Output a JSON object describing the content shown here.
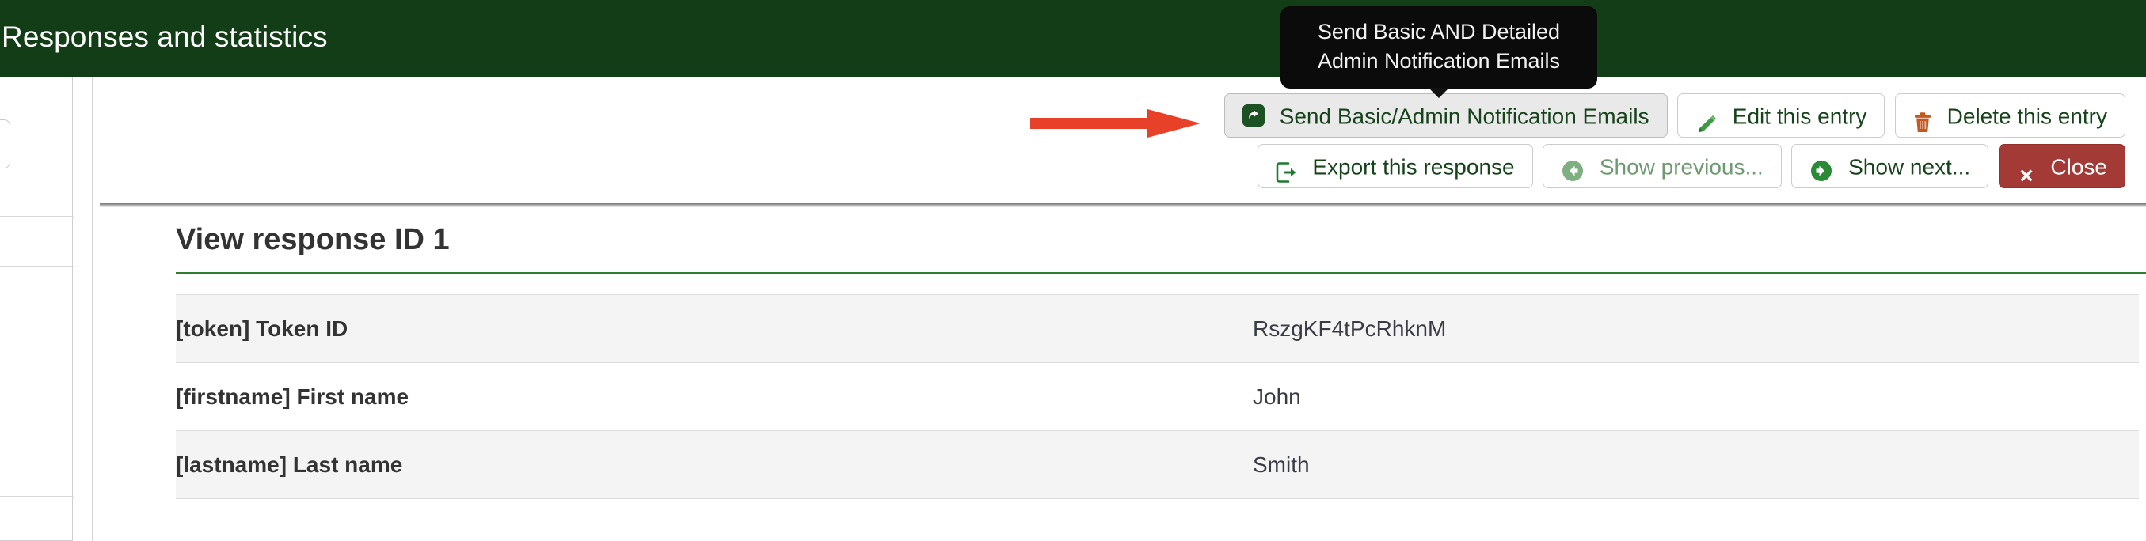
{
  "header": {
    "title": "Responses and statistics",
    "bg_color": "#123d16"
  },
  "tooltip": {
    "text": "Send Basic AND Detailed Admin Notification Emails"
  },
  "toolbar": {
    "row1": [
      {
        "id": "send-notification-emails",
        "label": "Send Basic/Admin Notification Emails",
        "icon": "share-square-icon",
        "state": "hovered"
      },
      {
        "id": "edit-entry",
        "label": "Edit this entry",
        "icon": "pencil-icon",
        "state": "normal"
      },
      {
        "id": "delete-entry",
        "label": "Delete this entry",
        "icon": "trash-icon",
        "state": "normal"
      }
    ],
    "row2": [
      {
        "id": "export-response",
        "label": "Export this response",
        "icon": "export-icon",
        "state": "normal"
      },
      {
        "id": "show-previous",
        "label": "Show previous...",
        "icon": "circle-arrow-left-icon",
        "state": "disabled"
      },
      {
        "id": "show-next",
        "label": "Show next...",
        "icon": "circle-arrow-right-icon",
        "state": "normal"
      },
      {
        "id": "close",
        "label": "Close",
        "icon": "times-icon",
        "state": "danger"
      }
    ]
  },
  "annotation": {
    "arrow_color": "#e8412a",
    "points_to": "send-notification-emails"
  },
  "panel": {
    "title": "View response ID 1",
    "accent_color": "#2e7d32"
  },
  "table": {
    "rows": [
      {
        "question": "[token] Token ID",
        "answer": "RszgKF4tPcRhknM"
      },
      {
        "question": "[firstname] First name",
        "answer": "John"
      },
      {
        "question": "[lastname] Last name",
        "answer": "Smith"
      }
    ]
  }
}
